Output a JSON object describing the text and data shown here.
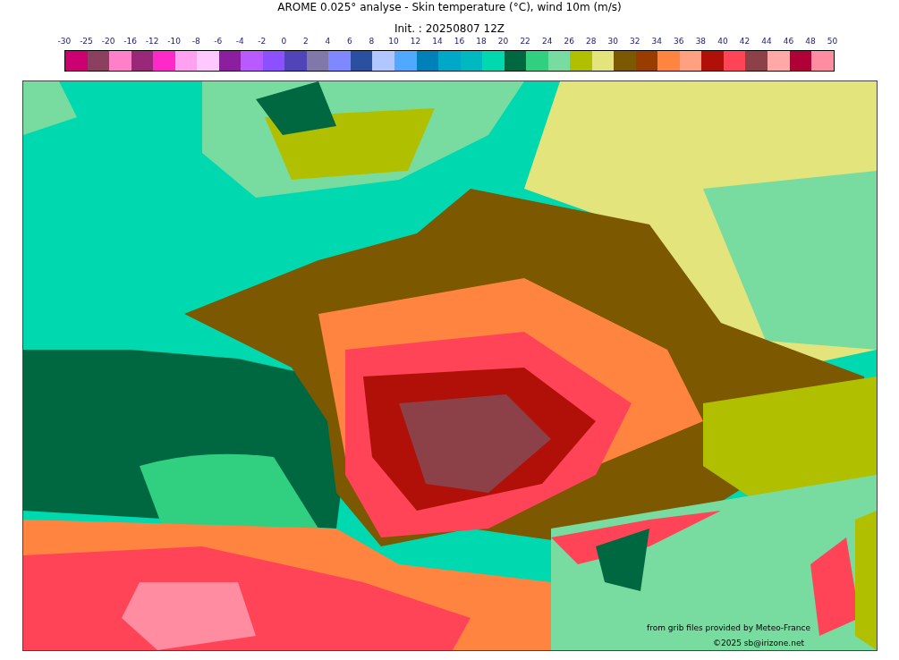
{
  "title": "AROME 0.025° analyse - Skin temperature (°C), wind 10m (m/s)",
  "subtitle": "Init. : 20250807 12Z",
  "colorbar": {
    "ticks": [
      "-30",
      "-25",
      "-20",
      "-16",
      "-12",
      "-10",
      "-8",
      "-6",
      "-4",
      "-2",
      "0",
      "2",
      "4",
      "6",
      "8",
      "10",
      "12",
      "14",
      "16",
      "18",
      "20",
      "22",
      "24",
      "26",
      "28",
      "30",
      "32",
      "34",
      "36",
      "38",
      "40",
      "42",
      "44",
      "46",
      "48",
      "50"
    ],
    "bins": [
      {
        "color": "#cc0070"
      },
      {
        "color": "#8b4060"
      },
      {
        "color": "#ff80c8"
      },
      {
        "color": "#9a2878"
      },
      {
        "color": "#ff28c8"
      },
      {
        "color": "#ffa0f0"
      },
      {
        "color": "#ffc8ff"
      },
      {
        "color": "#8c1ea0"
      },
      {
        "color": "#b85aff"
      },
      {
        "color": "#8c50ff"
      },
      {
        "color": "#5044b8"
      },
      {
        "color": "#8078a8"
      },
      {
        "color": "#8088ff"
      },
      {
        "color": "#2c50a0"
      },
      {
        "color": "#b0c8ff"
      },
      {
        "color": "#50a8ff"
      },
      {
        "color": "#0080b8"
      },
      {
        "color": "#00a8c8"
      },
      {
        "color": "#00b8c0"
      },
      {
        "color": "#00d8b0"
      },
      {
        "color": "#006840"
      },
      {
        "color": "#30d080"
      },
      {
        "color": "#78dca0"
      },
      {
        "color": "#b0c000"
      },
      {
        "color": "#e4e47c"
      },
      {
        "color": "#7c5800"
      },
      {
        "color": "#983c00"
      },
      {
        "color": "#ff8440"
      },
      {
        "color": "#ffa080"
      },
      {
        "color": "#b01008"
      },
      {
        "color": "#ff4458"
      },
      {
        "color": "#8c4048"
      },
      {
        "color": "#ffa8a8"
      },
      {
        "color": "#b00038"
      },
      {
        "color": "#ff8ca0"
      }
    ]
  },
  "map": {
    "credit": "from grib files provided by Meteo-France",
    "copyright": "©2025 sb@irizone.net"
  }
}
